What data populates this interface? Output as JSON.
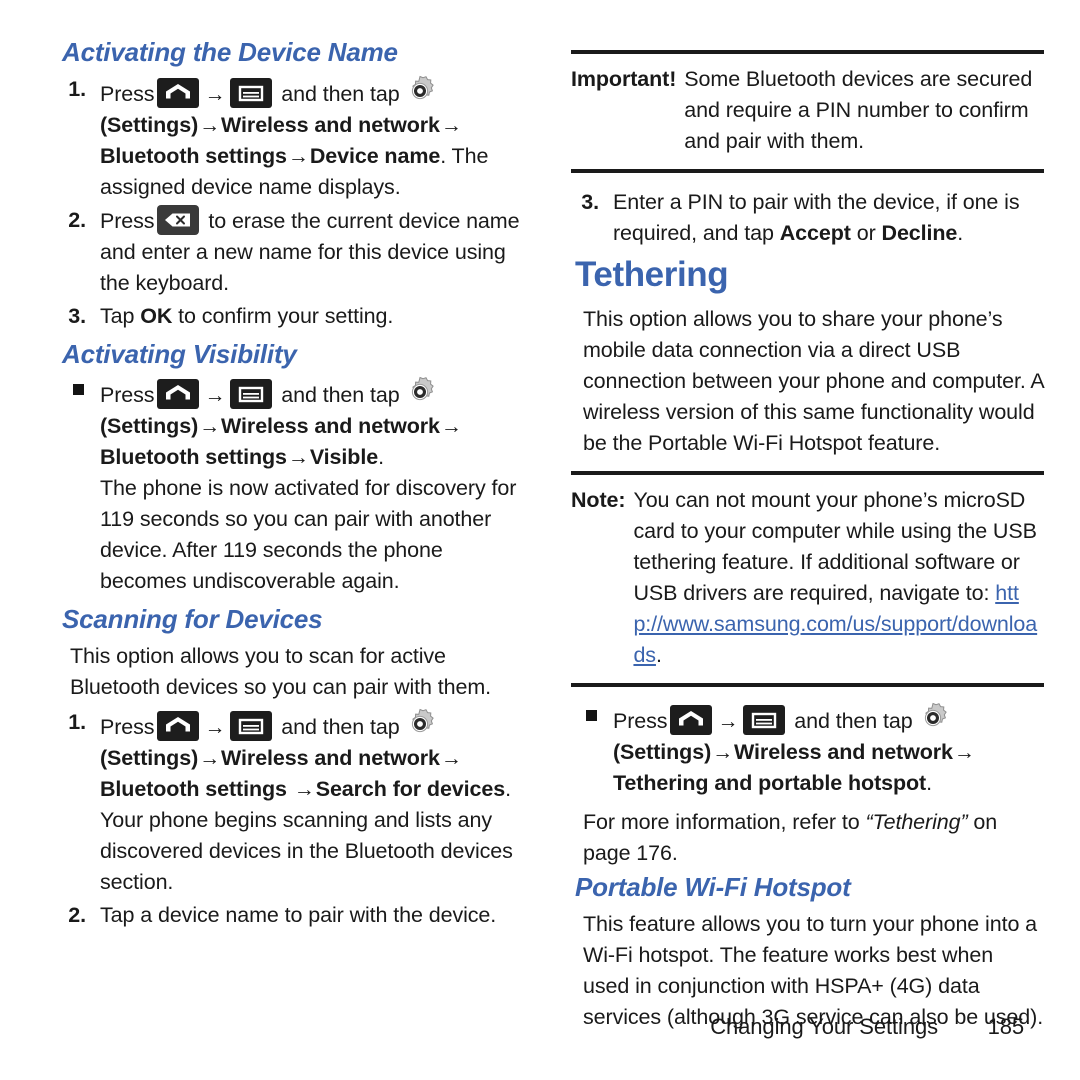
{
  "page": {
    "footer_title": "Changing Your Settings",
    "footer_page": "185",
    "accent_color": "#3b64ae",
    "text_color": "#1a1a1a"
  },
  "icons": {
    "home": "home-key-icon",
    "menu": "menu-key-icon",
    "gear": "settings-gear-icon",
    "backspace": "backspace-key-icon",
    "arrow": "right-arrow-icon",
    "bullet": "square-bullet-icon"
  },
  "left_column": {
    "sections": [
      {
        "heading": "Activating the Device Name",
        "steps": [
          {
            "marker": "1.",
            "t1": "Press",
            "t2": "and then tap",
            "t3": "(Settings)",
            "t4": "Wireless and network",
            "t5": "Bluetooth settings",
            "t6": "Device name",
            "t7": ". The assigned device name displays."
          },
          {
            "marker": "2.",
            "t1": "Press",
            "t2": "to erase the current device name and enter a new name for this device using the keyboard."
          },
          {
            "marker": "3.",
            "t1": "Tap ",
            "bold": "OK",
            "t2": " to confirm your setting."
          }
        ]
      },
      {
        "heading": "Activating Visibility",
        "steps": [
          {
            "marker": "bullet",
            "t1": "Press",
            "t2": "and then tap",
            "t3": "(Settings)",
            "t4": "Wireless and network",
            "t5": "Bluetooth settings",
            "t6": "Visible",
            "t7": ".",
            "t8": "The phone is now activated for discovery for 119 seconds so you can pair with another device. After 119 seconds the phone becomes undiscoverable again."
          }
        ]
      },
      {
        "heading": "Scanning for Devices",
        "intro": "This option allows you to scan for active Bluetooth devices so you can pair with them.",
        "steps": [
          {
            "marker": "1.",
            "t1": "Press",
            "t2": "and then tap",
            "t3": "(Settings)",
            "t4": "Wireless and network",
            "t5": "Bluetooth settings ",
            "t6": "Search for devices",
            "t7": ".",
            "t8": "Your phone begins scanning and lists any discovered devices in the Bluetooth devices section."
          },
          {
            "marker": "2.",
            "t1": "Tap a device name to pair with the device."
          }
        ]
      }
    ]
  },
  "right_column": {
    "important_note": {
      "label": "Important!",
      "text": "Some Bluetooth devices are secured and require a PIN number to confirm and pair with them."
    },
    "step3": {
      "marker": "3.",
      "t1": "Enter a PIN to pair with the device, if one is required, and tap ",
      "bold1": "Accept",
      "t2": " or ",
      "bold2": "Decline",
      "t3": "."
    },
    "tethering": {
      "heading": "Tethering",
      "body": "This option allows you to share your phone’s mobile data connection via a direct USB connection between your phone and computer. A wireless version of this same functionality would be the Portable Wi-Fi Hotspot feature."
    },
    "note": {
      "label": "Note:",
      "text_before": "You can not mount your phone’s microSD card to your computer while using the USB tethering feature. If additional software or USB drivers are required, navigate to: ",
      "link": "http://www.samsung.com/us/support/downloads",
      "text_after": "."
    },
    "tether_step": {
      "marker": "bullet",
      "t1": "Press",
      "t2": "and then tap",
      "t3": "(Settings)",
      "t4": "Wireless and network",
      "t5": "Tethering and portable hotspot",
      "t6": "."
    },
    "cross_ref": {
      "t1": "For more information, refer to ",
      "ital": "“Tethering”",
      "t2": " on page 176."
    },
    "hotspot": {
      "heading": "Portable Wi-Fi Hotspot",
      "body": "This feature allows you to turn your phone into a Wi-Fi hotspot. The feature works best when used in conjunction with HSPA+ (4G) data services (although 3G service can also be used)."
    }
  }
}
